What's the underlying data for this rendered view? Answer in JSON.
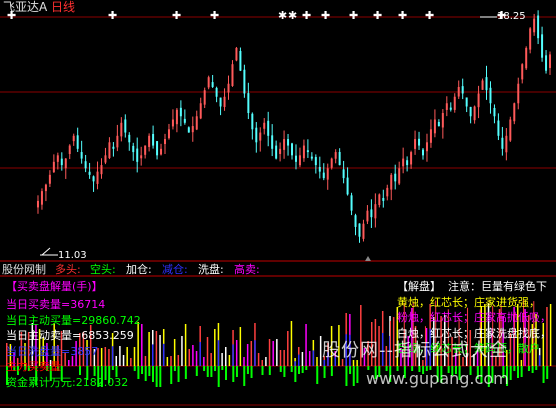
{
  "header": {
    "title": "飞亚达A",
    "period": "日线"
  },
  "price_labels": {
    "high": "18.25",
    "low": "11.03"
  },
  "indicator_bar": {
    "name": "股份网制",
    "items": [
      {
        "label": "多头:",
        "color": "#ff3030"
      },
      {
        "label": "空头:",
        "color": "#00ff00"
      },
      {
        "label": "加仓:",
        "color": "#ffffff"
      },
      {
        "label": "减仓:",
        "color": "#3030ff"
      },
      {
        "label": "洗盘:",
        "color": "#ffffff"
      },
      {
        "label": "高卖:",
        "color": "#ff00ff"
      }
    ]
  },
  "panel": {
    "title": "【买卖盘解量(手)】",
    "lines": [
      {
        "text": "当日买卖量=36714",
        "color": "#ff00ff"
      },
      {
        "text": "当日主动买量=29860.742",
        "color": "#00ff00"
      },
      {
        "text": "当日主动卖量=6853.259",
        "color": "#ffffff"
      },
      {
        "text": "当日洗盘量=3857",
        "color": "#3a3aff"
      },
      {
        "text": "主力买卖量",
        "color": "#ff0000"
      },
      {
        "text": "资金累计万元:2182.032",
        "color": "#00ff00"
      }
    ]
  },
  "legend": {
    "title": "【解盘】",
    "note": "注意：巨量有绿色下",
    "lines": [
      {
        "text": "黄烛，红芯长；庄家进货强，",
        "color": "#ffff00"
      },
      {
        "text": "粉烛，红芯长；庄家高抛低吸，",
        "color": "#ff00ff"
      },
      {
        "text": "白烛，红芯长；庄家洗盘找底，",
        "color": "#ffffff"
      },
      {
        "text": "巨绿，绿芯长；筹码顶，散户",
        "color": "#00ff00"
      }
    ]
  },
  "watermark": {
    "line1": "股份网--指标公式大全",
    "line2": "www.gupang.com"
  },
  "chart_data": {
    "type": "candlestick",
    "price_high": 18.25,
    "price_low": 11.03,
    "close_series": [
      12.6,
      12.9,
      13.1,
      13.4,
      13.8,
      14.0,
      13.7,
      13.9,
      14.3,
      14.6,
      14.2,
      13.9,
      13.6,
      13.4,
      13.2,
      13.5,
      13.7,
      14.0,
      14.4,
      14.2,
      14.6,
      15.0,
      14.7,
      14.4,
      14.1,
      13.8,
      14.0,
      14.3,
      14.6,
      14.3,
      14.0,
      14.2,
      14.5,
      14.8,
      15.1,
      15.4,
      15.2,
      15.0,
      14.7,
      14.9,
      15.2,
      15.6,
      16.0,
      16.4,
      16.1,
      15.8,
      15.5,
      15.8,
      16.2,
      16.8,
      17.3,
      16.6,
      15.9,
      15.3,
      14.8,
      14.4,
      14.7,
      15.0,
      14.6,
      14.2,
      13.9,
      14.2,
      14.5,
      14.3,
      14.0,
      13.8,
      14.0,
      14.3,
      14.1,
      13.9,
      13.7,
      13.5,
      13.3,
      13.6,
      13.9,
      14.1,
      13.7,
      13.3,
      12.8,
      12.3,
      11.8,
      11.5,
      11.9,
      12.3,
      12.1,
      12.5,
      12.8,
      12.6,
      13.0,
      13.4,
      13.2,
      13.6,
      13.9,
      13.7,
      14.1,
      14.5,
      14.3,
      14.0,
      14.4,
      14.8,
      15.1,
      14.9,
      15.3,
      15.6,
      15.4,
      15.8,
      16.1,
      15.9,
      15.5,
      15.2,
      15.5,
      15.9,
      16.3,
      16.0,
      15.6,
      15.2,
      14.6,
      14.2,
      14.6,
      15.1,
      15.6,
      16.2,
      16.8,
      17.3,
      17.9,
      18.2,
      17.6,
      17.0,
      16.6,
      17.1
    ]
  }
}
